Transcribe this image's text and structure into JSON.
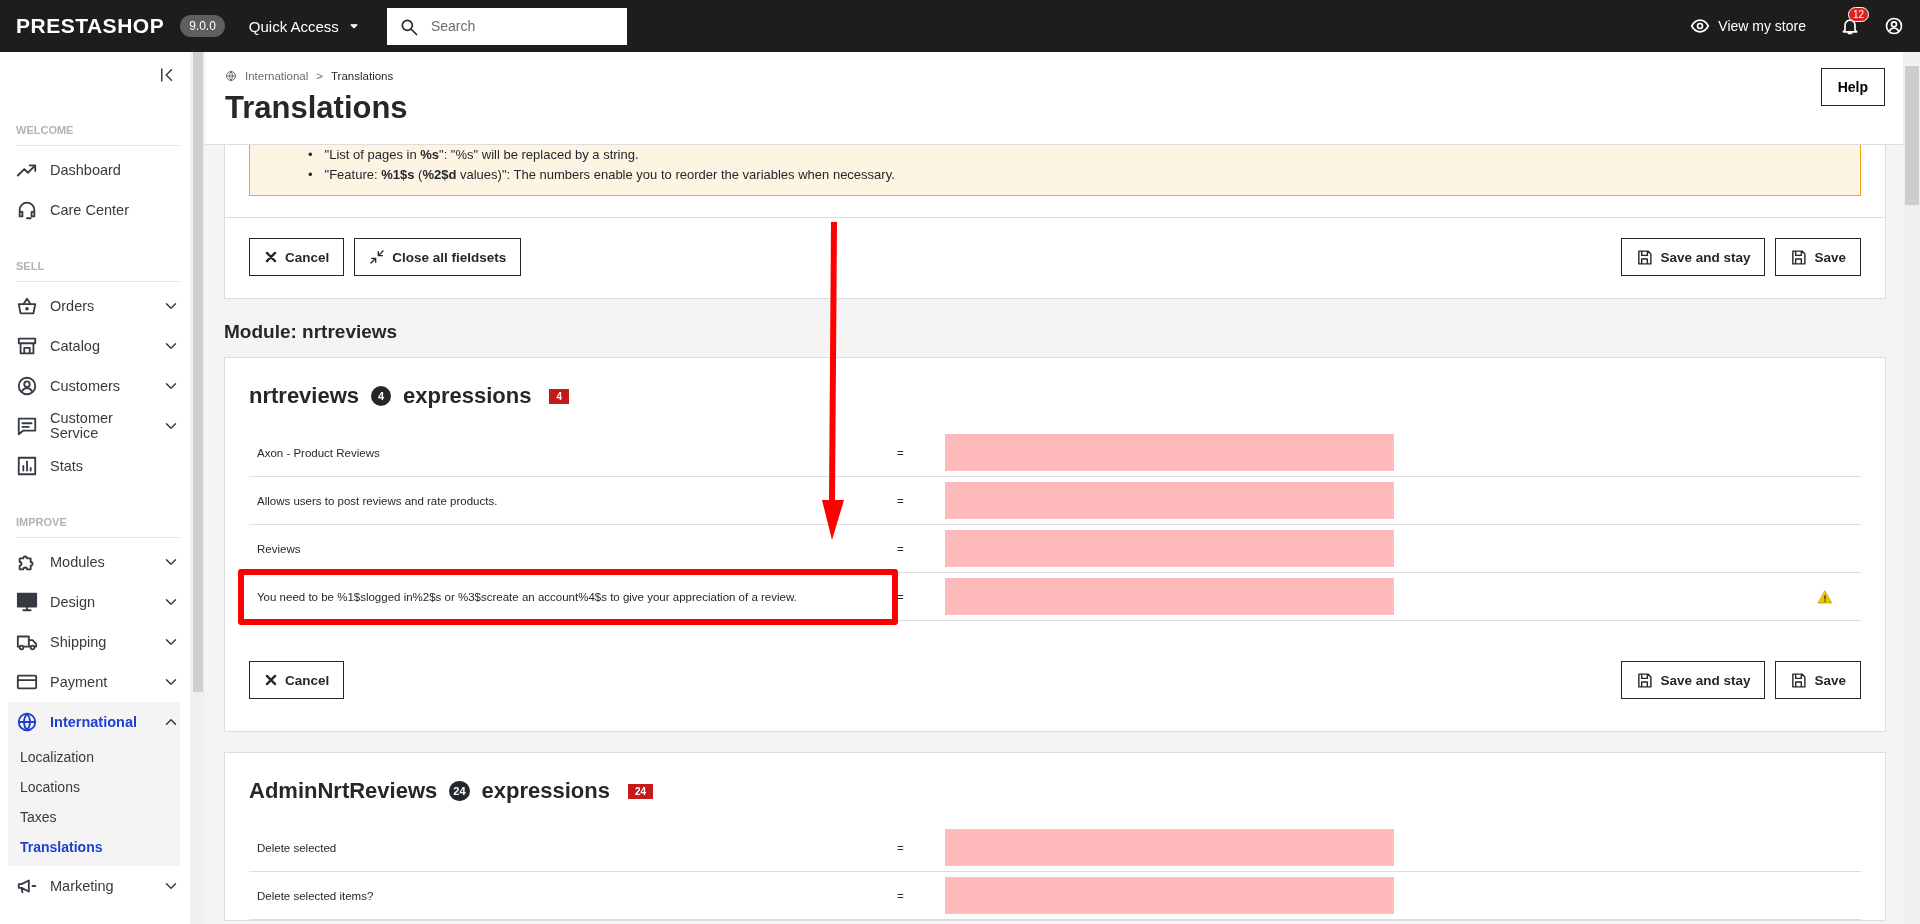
{
  "topbar": {
    "logo": "PRESTASHOP",
    "version": "9.0.0",
    "quick_access": "Quick Access",
    "search": {
      "placeholder": "Search"
    },
    "view_store": "View my store",
    "notifications": "12"
  },
  "sidebar": {
    "sections": [
      {
        "title": "WELCOME",
        "items": [
          {
            "label": "Dashboard",
            "expandable": false,
            "selected": false
          },
          {
            "label": "Care Center",
            "expandable": false,
            "selected": false
          }
        ]
      },
      {
        "title": "SELL",
        "items": [
          {
            "label": "Orders",
            "expandable": true,
            "expanded": false,
            "selected": false
          },
          {
            "label": "Catalog",
            "expandable": true,
            "expanded": false,
            "selected": false
          },
          {
            "label": "Customers",
            "expandable": true,
            "expanded": false,
            "selected": false
          },
          {
            "label": "Customer Service",
            "expandable": true,
            "expanded": false,
            "selected": false
          },
          {
            "label": "Stats",
            "expandable": false,
            "selected": false
          }
        ]
      },
      {
        "title": "IMPROVE",
        "items": [
          {
            "label": "Modules",
            "expandable": true,
            "expanded": false,
            "selected": false
          },
          {
            "label": "Design",
            "expandable": true,
            "expanded": false,
            "selected": false
          },
          {
            "label": "Shipping",
            "expandable": true,
            "expanded": false,
            "selected": false
          },
          {
            "label": "Payment",
            "expandable": true,
            "expanded": false,
            "selected": false
          },
          {
            "label": "International",
            "expandable": true,
            "expanded": true,
            "selected": true,
            "children": [
              {
                "label": "Localization",
                "selected": false
              },
              {
                "label": "Locations",
                "selected": false
              },
              {
                "label": "Taxes",
                "selected": false
              },
              {
                "label": "Translations",
                "selected": true
              }
            ]
          },
          {
            "label": "Marketing",
            "expandable": true,
            "expanded": false,
            "selected": false
          }
        ]
      }
    ]
  },
  "breadcrumb": {
    "items": [
      "International",
      "Translations"
    ],
    "separator": ">"
  },
  "page_title": "Translations",
  "help_button": "Help",
  "alert_lines": [
    {
      "bullet": "•",
      "text": "\"List of pages in **%s**\": \"%s\" will be replaced by a string."
    },
    {
      "bullet": "•",
      "text": "\"Feature: **%1$s** (**%2$d** values)\": The numbers enable you to reorder the variables when necessary."
    }
  ],
  "toolbar_buttons": [
    {
      "label": "Cancel",
      "kind": "cancel"
    },
    {
      "label": "Close all fieldsets",
      "kind": "collapse"
    },
    {
      "label": "Save and stay",
      "kind": "save"
    },
    {
      "label": "Save",
      "kind": "save"
    }
  ],
  "module_title": "Module: nrtreviews",
  "domains": [
    {
      "name": "nrtreviews",
      "count": "4",
      "label": "expressions",
      "missing_count": "4",
      "rows": [
        {
          "source": "Axon - Product Reviews",
          "equals": "=",
          "missing": true,
          "warning": false,
          "highlighted": false
        },
        {
          "source": "Allows users to post reviews and rate products.",
          "equals": "=",
          "missing": true,
          "warning": false,
          "highlighted": false
        },
        {
          "source": "Reviews",
          "equals": "=",
          "missing": true,
          "warning": false,
          "highlighted": false
        },
        {
          "source": "You need to be %1$slogged in%2$s or %3$screate an account%4$s to give your appreciation of a review.",
          "equals": "=",
          "missing": true,
          "warning": true,
          "highlighted": true
        }
      ],
      "buttons": [
        {
          "label": "Cancel",
          "kind": "cancel"
        },
        {
          "label": "Save and stay",
          "kind": "save"
        },
        {
          "label": "Save",
          "kind": "save"
        }
      ]
    },
    {
      "name": "AdminNrtReviews",
      "count": "24",
      "label": "expressions",
      "missing_count": "24",
      "rows": [
        {
          "source": "Delete selected",
          "equals": "=",
          "missing": true,
          "warning": false,
          "highlighted": false
        },
        {
          "source": "Delete selected items?",
          "equals": "=",
          "missing": true,
          "warning": false,
          "highlighted": false
        }
      ]
    }
  ]
}
